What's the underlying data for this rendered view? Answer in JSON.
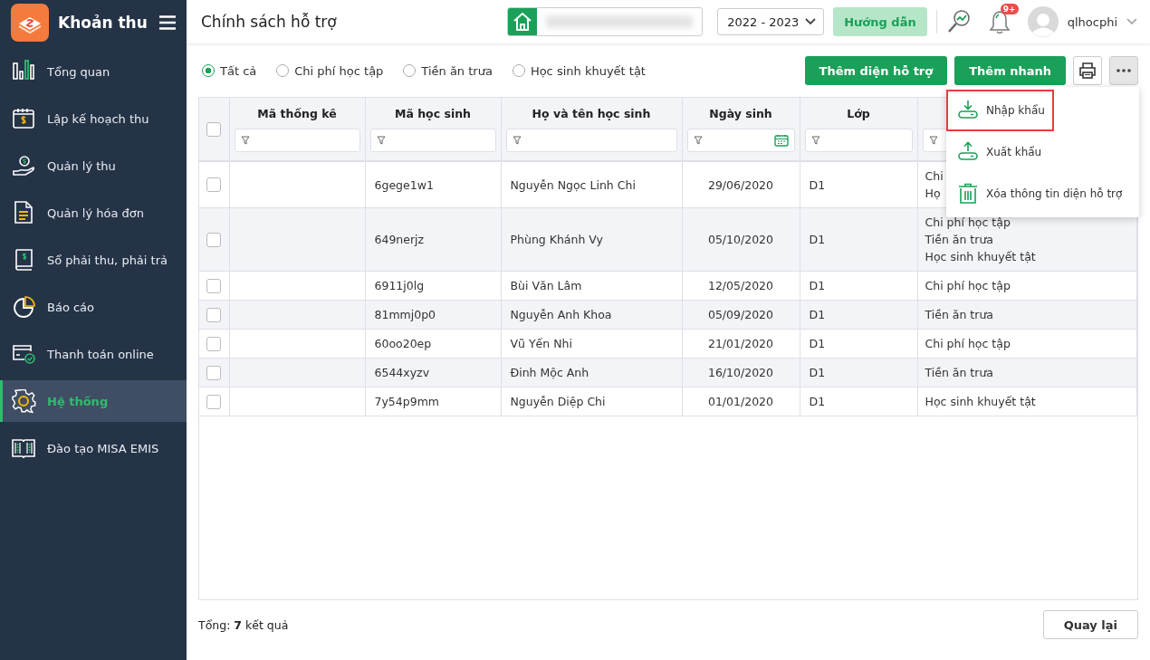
{
  "app": {
    "title": "Khoản thu"
  },
  "sidebar": {
    "items": [
      {
        "label": "Tổng quan",
        "kind": "chart",
        "selected": false
      },
      {
        "label": "Lập kế hoạch thu",
        "kind": "calendar",
        "selected": false
      },
      {
        "label": "Quản lý thu",
        "kind": "hand",
        "selected": false
      },
      {
        "label": "Quản lý hóa đơn",
        "kind": "doc",
        "selected": false
      },
      {
        "label": "Sổ phải thu, phải trả",
        "kind": "book",
        "selected": false
      },
      {
        "label": "Báo cáo",
        "kind": "pie",
        "selected": false
      },
      {
        "label": "Thanh toán online",
        "kind": "card",
        "selected": false
      },
      {
        "label": "Hệ thống",
        "kind": "gear",
        "selected": true
      },
      {
        "label": "Đào tạo MISA EMIS",
        "kind": "openbook",
        "selected": false
      }
    ]
  },
  "header": {
    "title": "Chính sách hỗ trợ",
    "year": "2022 - 2023",
    "guide_button": "Hướng dẫn",
    "notification_badge": "9+",
    "user": "qlhocphi"
  },
  "filters": [
    {
      "label": "Tất cả",
      "selected": true
    },
    {
      "label": "Chi phí học tập",
      "selected": false
    },
    {
      "label": "Tiền ăn trưa",
      "selected": false
    },
    {
      "label": "Học sinh khuyết tật",
      "selected": false
    }
  ],
  "actions": [
    "Thêm diện hỗ trợ",
    "Thêm nhanh"
  ],
  "menu": [
    {
      "label": "Nhập khẩu",
      "kind": "import",
      "highlighted": true
    },
    {
      "label": "Xuất khẩu",
      "kind": "export",
      "highlighted": false
    },
    {
      "label": "Xóa thông tin diện hỗ trợ",
      "kind": "delete",
      "highlighted": false
    }
  ],
  "table": {
    "all_checked": false,
    "columns": [
      {
        "label": "Mã thống kê",
        "kind": "text"
      },
      {
        "label": "Mã học sinh",
        "kind": "text"
      },
      {
        "label": "Họ và tên học sinh",
        "kind": "text"
      },
      {
        "label": "Ngày sinh",
        "kind": "date"
      },
      {
        "label": "Lớp",
        "kind": "text"
      },
      {
        "kind": "text"
      }
    ],
    "rows": [
      {
        "checked": false,
        "cells": [
          "",
          "6gege1w1",
          "Nguyễn Ngọc Linh Chi",
          "29/06/2020",
          "D1"
        ],
        "supports": [
          "Chi",
          "Họ"
        ]
      },
      {
        "checked": false,
        "cells": [
          "",
          "649nerjz",
          "Phùng Khánh Vy",
          "05/10/2020",
          "D1"
        ],
        "supports": [
          "Chi phí học tập",
          "Tiền ăn trưa",
          "Học sinh khuyết tật"
        ]
      },
      {
        "checked": false,
        "cells": [
          "",
          "6911j0lg",
          "Bùi Văn Lâm",
          "12/05/2020",
          "D1"
        ],
        "supports": [
          "Chi phí học tập"
        ]
      },
      {
        "checked": false,
        "cells": [
          "",
          "81mmj0p0",
          "Nguyễn Anh Khoa",
          "05/09/2020",
          "D1"
        ],
        "supports": [
          "Tiền ăn trưa"
        ]
      },
      {
        "checked": false,
        "cells": [
          "",
          "60oo20ep",
          "Vũ Yến Nhi",
          "21/01/2020",
          "D1"
        ],
        "supports": [
          "Chi phí học tập"
        ]
      },
      {
        "checked": false,
        "cells": [
          "",
          "6544xyzv",
          "Đinh Mộc Anh",
          "16/10/2020",
          "D1"
        ],
        "supports": [
          "Tiền ăn trưa"
        ]
      },
      {
        "checked": false,
        "cells": [
          "",
          "7y54p9mm",
          "Nguyễn Diệp Chi",
          "01/01/2020",
          "D1"
        ],
        "supports": [
          "Học sinh khuyết tật"
        ]
      }
    ]
  },
  "footer": {
    "total": "Tổng: **7** kết quả",
    "back_button": "Quay lại"
  }
}
